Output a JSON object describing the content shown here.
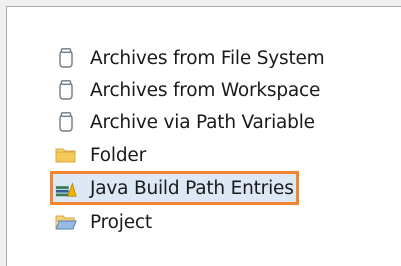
{
  "list": {
    "items": [
      {
        "label": "Archives from File System",
        "icon": "jar-icon"
      },
      {
        "label": "Archives from Workspace",
        "icon": "jar-icon"
      },
      {
        "label": "Archive via Path Variable",
        "icon": "jar-icon"
      },
      {
        "label": "Folder",
        "icon": "folder-icon"
      },
      {
        "label": "Java Build Path Entries",
        "icon": "java-build-path-icon",
        "selected": true
      },
      {
        "label": "Project",
        "icon": "open-folder-icon"
      }
    ]
  },
  "colors": {
    "selection_highlight": "#f2852f",
    "selection_background": "#dde8f6",
    "folder": "#f5c85a",
    "jar": "#6e7b85"
  }
}
